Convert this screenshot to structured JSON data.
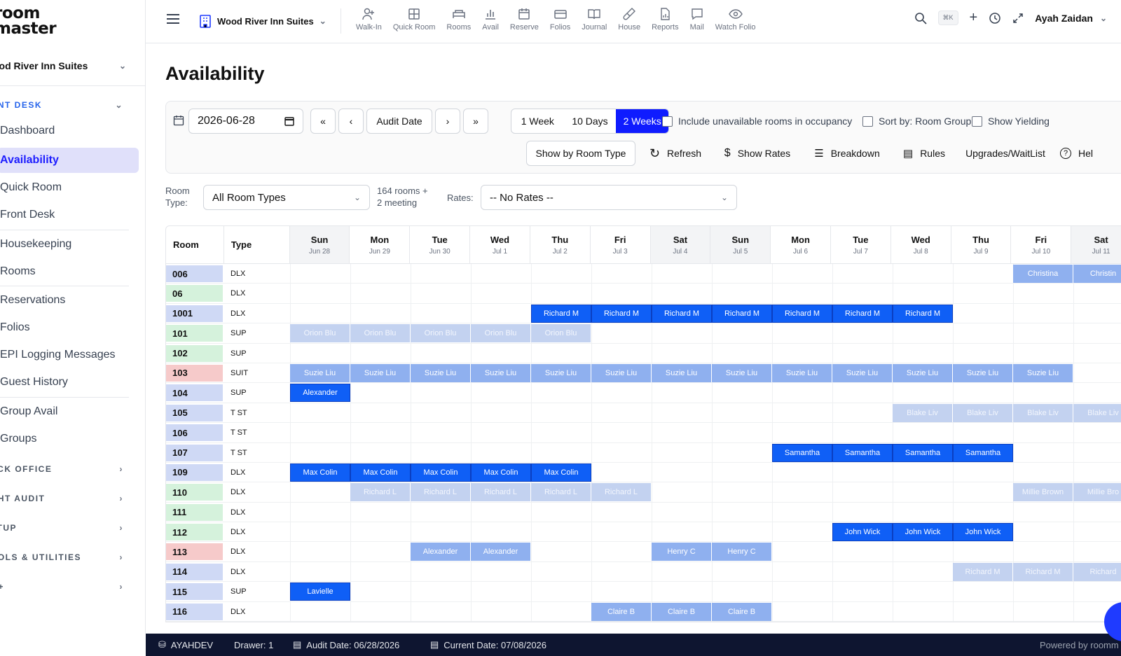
{
  "app": {
    "logo_line1": "room",
    "logo_line2": "master"
  },
  "sidebar": {
    "hotel": "ood River Inn Suites",
    "sections": {
      "front_desk": "ONT DESK",
      "back_office": "ACK OFFICE",
      "night_audit": "GHT AUDIT",
      "setup": "ETUP",
      "tools": "OOLS & UTILITIES",
      "rm_plus": "M+"
    },
    "items": [
      "Dashboard",
      "Availability",
      "Quick Room",
      "Front Desk",
      "Housekeeping",
      "Rooms",
      "Reservations",
      "Folios",
      "EPI Logging Messages",
      "Guest History",
      "Group Avail",
      "Groups"
    ]
  },
  "topbar": {
    "hotel": "Wood River Inn Suites",
    "tools": [
      "Walk-In",
      "Quick Room",
      "Rooms",
      "Avail",
      "Reserve",
      "Folios",
      "Journal",
      "House",
      "Reports",
      "Mail",
      "Watch Folio"
    ],
    "shortcut": "⌘K",
    "user": "Ayah Zaidan"
  },
  "page": {
    "title": "Availability"
  },
  "controls": {
    "date": "2026-06-28",
    "audit_date_btn": "Audit Date",
    "ranges": [
      "1 Week",
      "10 Days",
      "2 Weeks"
    ],
    "chk_unavailable": "Include unavailable rooms in occupancy",
    "chk_sort": "Sort by: Room Group",
    "chk_yielding": "Show Yielding",
    "show_by_room_type": "Show by Room Type",
    "refresh": "Refresh",
    "show_rates": "Show Rates",
    "breakdown": "Breakdown",
    "rules": "Rules",
    "upgrades": "Upgrades/WaitList",
    "help": "Hel"
  },
  "filters": {
    "room_type_label_1": "Room",
    "room_type_label_2": "Type:",
    "room_type_value": "All Room Types",
    "count_1": "164 rooms +",
    "count_2": "2 meeting",
    "rates_label": "Rates:",
    "rates_value": "-- No Rates --"
  },
  "grid": {
    "col_room": "Room",
    "col_type": "Type",
    "days": [
      {
        "dow": "Sun",
        "date": "Jun 28"
      },
      {
        "dow": "Mon",
        "date": "Jun 29"
      },
      {
        "dow": "Tue",
        "date": "Jun 30"
      },
      {
        "dow": "Wed",
        "date": "Jul 1"
      },
      {
        "dow": "Thu",
        "date": "Jul 2"
      },
      {
        "dow": "Fri",
        "date": "Jul 3"
      },
      {
        "dow": "Sat",
        "date": "Jul 4"
      },
      {
        "dow": "Sun",
        "date": "Jul 5"
      },
      {
        "dow": "Mon",
        "date": "Jul 6"
      },
      {
        "dow": "Tue",
        "date": "Jul 7"
      },
      {
        "dow": "Wed",
        "date": "Jul 8"
      },
      {
        "dow": "Thu",
        "date": "Jul 9"
      },
      {
        "dow": "Fri",
        "date": "Jul 10"
      },
      {
        "dow": "Sat",
        "date": "Jul 11"
      }
    ],
    "rows": [
      {
        "room": "006",
        "type": "DLX",
        "color": "blue",
        "res": [
          {
            "s": 12,
            "n": 1,
            "name": "Christina",
            "style": "light"
          },
          {
            "s": 13,
            "n": 1,
            "name": "Christin",
            "style": "light"
          }
        ]
      },
      {
        "room": "06",
        "type": "DLX",
        "color": "green",
        "res": []
      },
      {
        "room": "1001",
        "type": "DLX",
        "color": "blue",
        "res": [
          {
            "s": 4,
            "n": 1,
            "name": "Richard M",
            "style": "solid"
          },
          {
            "s": 5,
            "n": 1,
            "name": "Richard M",
            "style": "solid"
          },
          {
            "s": 6,
            "n": 1,
            "name": "Richard M",
            "style": "solid"
          },
          {
            "s": 7,
            "n": 1,
            "name": "Richard M",
            "style": "solid"
          },
          {
            "s": 8,
            "n": 1,
            "name": "Richard M",
            "style": "solid"
          },
          {
            "s": 9,
            "n": 1,
            "name": "Richard M",
            "style": "solid"
          },
          {
            "s": 10,
            "n": 1,
            "name": "Richard M",
            "style": "solid"
          }
        ]
      },
      {
        "room": "101",
        "type": "SUP",
        "color": "green",
        "res": [
          {
            "s": 0,
            "n": 1,
            "name": "Orion Blu",
            "style": "pale"
          },
          {
            "s": 1,
            "n": 1,
            "name": "Orion Blu",
            "style": "pale"
          },
          {
            "s": 2,
            "n": 1,
            "name": "Orion Blu",
            "style": "pale"
          },
          {
            "s": 3,
            "n": 1,
            "name": "Orion Blu",
            "style": "pale"
          },
          {
            "s": 4,
            "n": 1,
            "name": "Orion Blu",
            "style": "pale"
          }
        ]
      },
      {
        "room": "102",
        "type": "SUP",
        "color": "green",
        "res": []
      },
      {
        "room": "103",
        "type": "SUIT",
        "color": "red",
        "res": [
          {
            "s": 0,
            "n": 1,
            "name": "Suzie Liu",
            "style": "light"
          },
          {
            "s": 1,
            "n": 1,
            "name": "Suzie Liu",
            "style": "light"
          },
          {
            "s": 2,
            "n": 1,
            "name": "Suzie Liu",
            "style": "light"
          },
          {
            "s": 3,
            "n": 1,
            "name": "Suzie Liu",
            "style": "light"
          },
          {
            "s": 4,
            "n": 1,
            "name": "Suzie Liu",
            "style": "light"
          },
          {
            "s": 5,
            "n": 1,
            "name": "Suzie Liu",
            "style": "light"
          },
          {
            "s": 6,
            "n": 1,
            "name": "Suzie Liu",
            "style": "light"
          },
          {
            "s": 7,
            "n": 1,
            "name": "Suzie Liu",
            "style": "light"
          },
          {
            "s": 8,
            "n": 1,
            "name": "Suzie Liu",
            "style": "light"
          },
          {
            "s": 9,
            "n": 1,
            "name": "Suzie Liu",
            "style": "light"
          },
          {
            "s": 10,
            "n": 1,
            "name": "Suzie Liu",
            "style": "light"
          },
          {
            "s": 11,
            "n": 1,
            "name": "Suzie Liu",
            "style": "light"
          },
          {
            "s": 12,
            "n": 1,
            "name": "Suzie Liu",
            "style": "light"
          }
        ]
      },
      {
        "room": "104",
        "type": "SUP",
        "color": "blue",
        "res": [
          {
            "s": 0,
            "n": 1,
            "name": "Alexander",
            "style": "solid"
          }
        ]
      },
      {
        "room": "105",
        "type": "T ST",
        "color": "blue",
        "res": [
          {
            "s": 10,
            "n": 1,
            "name": "Blake Liv",
            "style": "pale"
          },
          {
            "s": 11,
            "n": 1,
            "name": "Blake Liv",
            "style": "pale"
          },
          {
            "s": 12,
            "n": 1,
            "name": "Blake Liv",
            "style": "pale"
          },
          {
            "s": 13,
            "n": 1,
            "name": "Blake Liv",
            "style": "pale"
          }
        ]
      },
      {
        "room": "106",
        "type": "T ST",
        "color": "blue",
        "res": []
      },
      {
        "room": "107",
        "type": "T ST",
        "color": "blue",
        "res": [
          {
            "s": 8,
            "n": 1,
            "name": "Samantha",
            "style": "solid"
          },
          {
            "s": 9,
            "n": 1,
            "name": "Samantha",
            "style": "solid"
          },
          {
            "s": 10,
            "n": 1,
            "name": "Samantha",
            "style": "solid"
          },
          {
            "s": 11,
            "n": 1,
            "name": "Samantha",
            "style": "solid"
          }
        ]
      },
      {
        "room": "109",
        "type": "DLX",
        "color": "blue",
        "res": [
          {
            "s": 0,
            "n": 1,
            "name": "Max Colin",
            "style": "solid"
          },
          {
            "s": 1,
            "n": 1,
            "name": "Max Colin",
            "style": "solid"
          },
          {
            "s": 2,
            "n": 1,
            "name": "Max Colin",
            "style": "solid"
          },
          {
            "s": 3,
            "n": 1,
            "name": "Max Colin",
            "style": "solid"
          },
          {
            "s": 4,
            "n": 1,
            "name": "Max Colin",
            "style": "solid"
          }
        ]
      },
      {
        "room": "110",
        "type": "DLX",
        "color": "green",
        "res": [
          {
            "s": 1,
            "n": 1,
            "name": "Richard L",
            "style": "pale"
          },
          {
            "s": 2,
            "n": 1,
            "name": "Richard L",
            "style": "pale"
          },
          {
            "s": 3,
            "n": 1,
            "name": "Richard L",
            "style": "pale"
          },
          {
            "s": 4,
            "n": 1,
            "name": "Richard L",
            "style": "pale"
          },
          {
            "s": 5,
            "n": 1,
            "name": "Richard L",
            "style": "pale"
          },
          {
            "s": 12,
            "n": 1,
            "name": "Millie Brown",
            "style": "pale"
          },
          {
            "s": 13,
            "n": 1,
            "name": "Millie Bro",
            "style": "pale"
          }
        ]
      },
      {
        "room": "111",
        "type": "DLX",
        "color": "green",
        "res": []
      },
      {
        "room": "112",
        "type": "DLX",
        "color": "green",
        "res": [
          {
            "s": 9,
            "n": 1,
            "name": "John Wick",
            "style": "solid"
          },
          {
            "s": 10,
            "n": 1,
            "name": "John Wick",
            "style": "solid"
          },
          {
            "s": 11,
            "n": 1,
            "name": "John Wick",
            "style": "solid"
          }
        ]
      },
      {
        "room": "113",
        "type": "DLX",
        "color": "red",
        "res": [
          {
            "s": 2,
            "n": 1,
            "name": "Alexander",
            "style": "light"
          },
          {
            "s": 3,
            "n": 1,
            "name": "Alexander",
            "style": "light"
          },
          {
            "s": 6,
            "n": 1,
            "name": "Henry C",
            "style": "light"
          },
          {
            "s": 7,
            "n": 1,
            "name": "Henry C",
            "style": "light"
          }
        ]
      },
      {
        "room": "114",
        "type": "DLX",
        "color": "blue",
        "res": [
          {
            "s": 11,
            "n": 1,
            "name": "Richard M",
            "style": "pale"
          },
          {
            "s": 12,
            "n": 1,
            "name": "Richard M",
            "style": "pale"
          },
          {
            "s": 13,
            "n": 1,
            "name": "Richard",
            "style": "pale"
          }
        ]
      },
      {
        "room": "115",
        "type": "SUP",
        "color": "blue",
        "res": [
          {
            "s": 0,
            "n": 1,
            "name": "Lavielle",
            "style": "solid"
          }
        ]
      },
      {
        "room": "116",
        "type": "DLX",
        "color": "blue",
        "res": [
          {
            "s": 5,
            "n": 1,
            "name": "Claire B",
            "style": "light"
          },
          {
            "s": 6,
            "n": 1,
            "name": "Claire B",
            "style": "light"
          },
          {
            "s": 7,
            "n": 1,
            "name": "Claire B",
            "style": "light"
          }
        ]
      }
    ]
  },
  "footer": {
    "user": "AYAHDEV",
    "drawer": "Drawer: 1",
    "audit_date": "Audit Date: 06/28/2026",
    "current_date": "Current Date: 07/08/2026",
    "powered": "Powered by roomm"
  },
  "colors": {
    "accent": "#0f1cff",
    "solid": "#0f5ff6",
    "light": "#8fb0ef",
    "pale": "#c3d2f0",
    "footer": "#0e1530"
  }
}
